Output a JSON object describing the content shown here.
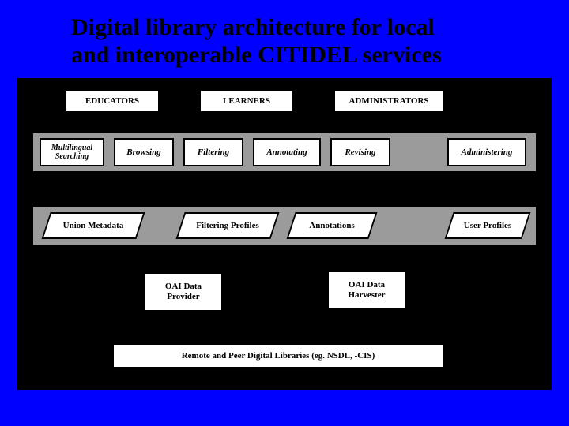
{
  "title_line1": "Digital library architecture for local",
  "title_line2": "and interoperable CITIDEL services",
  "top_boxes": {
    "educators": "EDUCATORS",
    "learners": "LEARNERS",
    "administrators": "ADMINISTRATORS"
  },
  "activity_row": {
    "multilingual": "Multilingual Searching",
    "browsing": "Browsing",
    "filtering": "Filtering",
    "annotating": "Annotating",
    "revising": "Revising",
    "administering": "Administering"
  },
  "data_row": {
    "union_metadata": "Union Metadata",
    "filtering_profiles": "Filtering Profiles",
    "annotations": "Annotations",
    "user_profiles": "User Profiles"
  },
  "oai": {
    "provider": "OAI Data Provider",
    "harvester": "OAI Data Harvester"
  },
  "footer_box": "Remote and Peer Digital Libraries (eg. NSDL, -CIS)"
}
